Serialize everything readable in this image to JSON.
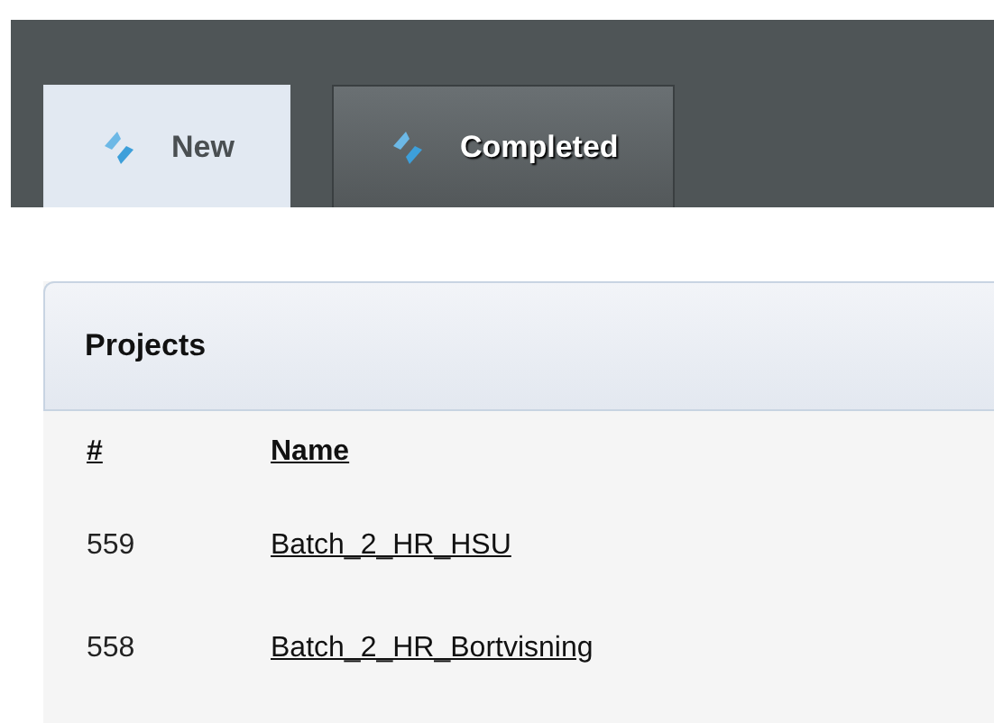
{
  "tabs": [
    {
      "label": "New",
      "selected": true
    },
    {
      "label": "Completed",
      "selected": false
    }
  ],
  "panel": {
    "title": "Projects",
    "columns": [
      "#",
      "Name"
    ],
    "rows": [
      {
        "number": "559",
        "name": "Batch_2_HR_HSU"
      },
      {
        "number": "558",
        "name": "Batch_2_HR_Bortvisning"
      }
    ]
  }
}
